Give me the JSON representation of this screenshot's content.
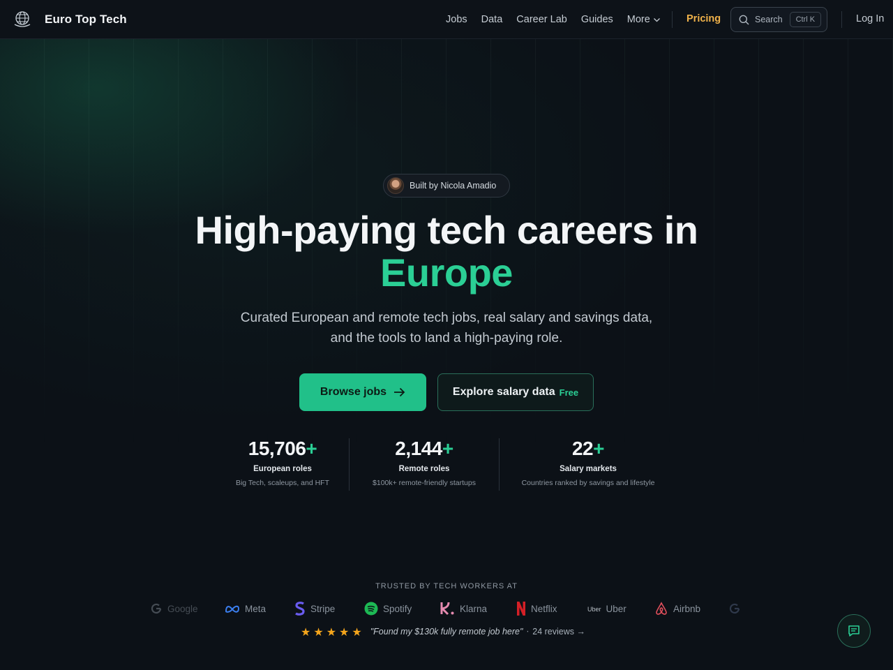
{
  "brand": {
    "name": "Euro Top Tech"
  },
  "nav": {
    "links": [
      "Jobs",
      "Data",
      "Career Lab",
      "Guides"
    ],
    "more_label": "More",
    "pricing_label": "Pricing",
    "search_placeholder": "Search",
    "search_shortcut": "Ctrl K",
    "login_label": "Log In"
  },
  "hero": {
    "badge_text": "Built by Nicola Amadio",
    "title_line1": "High-paying tech careers in",
    "title_accent": "Europe",
    "subtitle": "Curated European and remote tech jobs, real salary and savings data, and the tools to land a high-paying role.",
    "primary_cta": "Browse jobs",
    "secondary_cta": "Explore salary data",
    "secondary_tag": "Free"
  },
  "stats": [
    {
      "value": "15,706",
      "suffix": "+",
      "label": "European roles",
      "desc": "Big Tech, scaleups, and HFT"
    },
    {
      "value": "2,144",
      "suffix": "+",
      "label": "Remote roles",
      "desc": "$100k+ remote-friendly startups"
    },
    {
      "value": "22",
      "suffix": "+",
      "label": "Salary markets",
      "desc": "Countries ranked by savings and lifestyle"
    }
  ],
  "trusted": {
    "heading": "TRUSTED BY TECH WORKERS AT",
    "companies": [
      "Google",
      "Meta",
      "Stripe",
      "Spotify",
      "Klarna",
      "Netflix",
      "Uber",
      "Airbnb"
    ],
    "uber_wordmark": "Uber"
  },
  "review": {
    "stars": "★★★★★",
    "quote": "\"Found my $130k fully remote job here\"",
    "separator": "·",
    "count_link": "24 reviews →"
  },
  "colors": {
    "accent_green": "#2bcf95",
    "primary_button": "#21c089",
    "pricing_gold": "#f0b24a",
    "star_gold": "#f4a51c",
    "background": "#0c1117"
  }
}
